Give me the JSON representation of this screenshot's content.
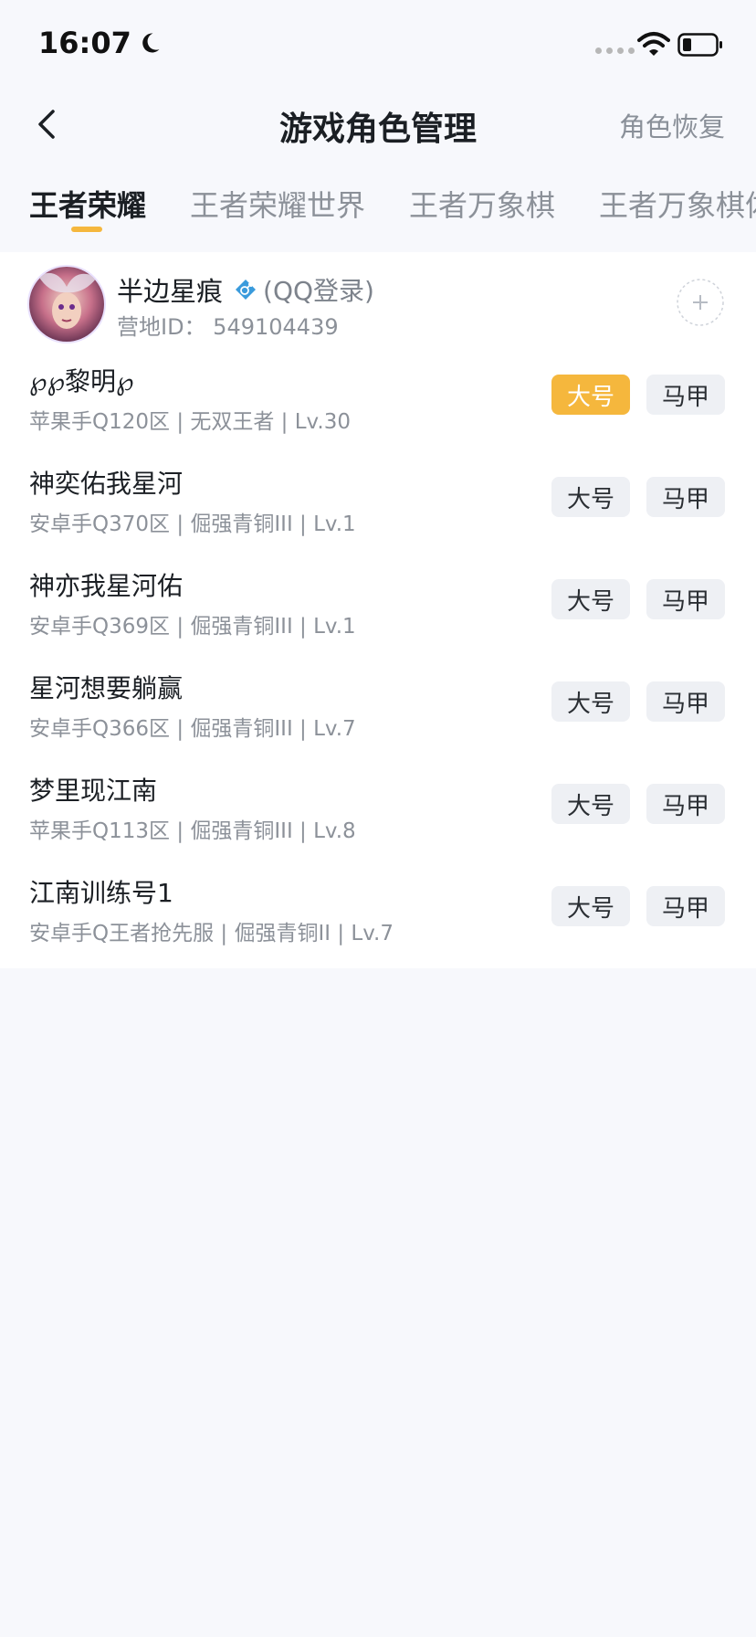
{
  "status": {
    "time": "16:07"
  },
  "header": {
    "title": "游戏角色管理",
    "restore": "角色恢复"
  },
  "tabs": [
    {
      "label": "王者荣耀",
      "active": true
    },
    {
      "label": "王者荣耀世界",
      "active": false
    },
    {
      "label": "王者万象棋",
      "active": false
    },
    {
      "label": "王者万象棋体",
      "active": false
    }
  ],
  "profile": {
    "name": "半边星痕",
    "login": "(QQ登录)",
    "camp_id": "营地ID：  549104439"
  },
  "buttons": {
    "main": "大号",
    "alt": "马甲"
  },
  "roles": [
    {
      "name": "℘℘黎明℘",
      "info": "苹果手Q120区 | 无双王者 | Lv.30",
      "main_selected": true
    },
    {
      "name": "神奕佑我星河",
      "info": "安卓手Q370区 | 倔强青铜III | Lv.1",
      "main_selected": false
    },
    {
      "name": "神亦我星河佑",
      "info": "安卓手Q369区 | 倔强青铜III | Lv.1",
      "main_selected": false
    },
    {
      "name": "星河想要躺赢",
      "info": "安卓手Q366区 | 倔强青铜III | Lv.7",
      "main_selected": false
    },
    {
      "name": "梦里现江南",
      "info": "苹果手Q113区 | 倔强青铜III | Lv.8",
      "main_selected": false
    },
    {
      "name": "江南训练号1",
      "info": "安卓手Q王者抢先服 | 倔强青铜II | Lv.7",
      "main_selected": false
    }
  ],
  "colors": {
    "accent": "#f5b73d",
    "gender": "#3a9bdc"
  }
}
